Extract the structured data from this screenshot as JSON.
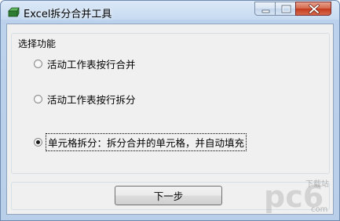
{
  "window": {
    "title": "Excel拆分合并工具"
  },
  "group": {
    "title": "选择功能",
    "options": [
      {
        "label": "活动工作表按行合并",
        "checked": false
      },
      {
        "label": "活动工作表按行拆分",
        "checked": false
      },
      {
        "label": "单元格拆分：拆分合并的单元格，并自动填充",
        "checked": true
      }
    ]
  },
  "footer": {
    "next_label": "下一步"
  },
  "watermark": {
    "brand": "pc6",
    "site": "下载站",
    "domain": "com"
  },
  "icons": {
    "app": "excel-tool-icon",
    "minimize": "minimize-icon",
    "maximize": "maximize-icon",
    "close": "close-icon"
  }
}
